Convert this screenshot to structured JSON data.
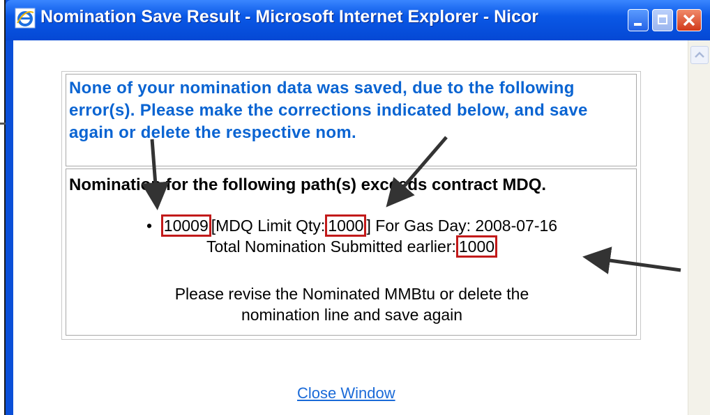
{
  "window": {
    "title": "Nomination Save Result - Microsoft Internet Explorer - Nicor"
  },
  "message": {
    "error_text": "None of your nomination data was saved, due to the following error(s). Please make the corrections indicated below, and save again or delete the respective nom.",
    "path_heading": "Nomination for the following path(s) exceeds contract MDQ.",
    "path_id": "10009",
    "mdq_label": "[MDQ Limit Qty:",
    "mdq_value": "1000",
    "gas_day_text": "] For Gas Day: 2008-07-16",
    "total_label": "Total Nomination Submitted earlier:",
    "total_value": "1000",
    "revise_line1": "Please revise the Nominated MMBtu or delete the",
    "revise_line2": "nomination line and save again"
  },
  "footer": {
    "close_link": "Close Window"
  },
  "colors": {
    "titlebar": "#0a58e6",
    "error_text": "#0a64d2",
    "highlight_box": "#c21a1a",
    "link": "#1a6ad8"
  }
}
